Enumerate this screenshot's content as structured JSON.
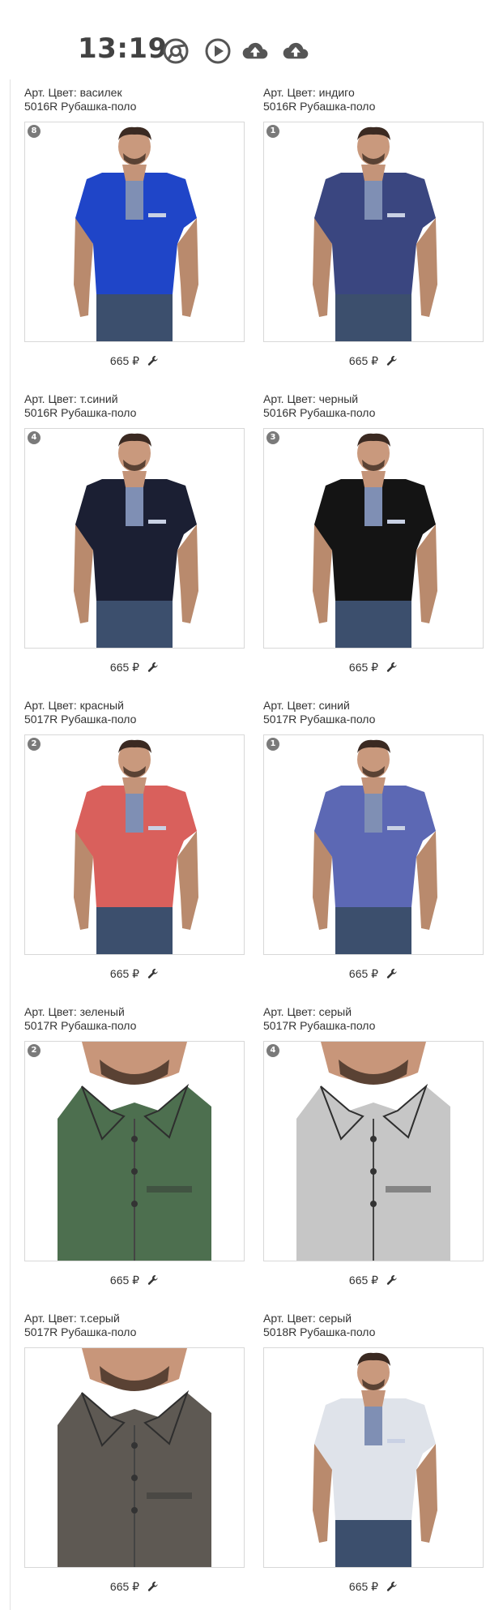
{
  "status_bar": {
    "time": "13:19",
    "icons": [
      "chrome-icon",
      "play-circle-icon",
      "cloud-upload-icon",
      "cloud-upload-icon"
    ]
  },
  "products": [
    {
      "color": "Арт. Цвет: василек",
      "model": "5016R Рубашка-поло",
      "badge": "8",
      "price": "665 ₽",
      "shirt_color": "#1f45c8",
      "photo": "full"
    },
    {
      "color": "Арт. Цвет: индиго",
      "model": "5016R Рубашка-поло",
      "badge": "1",
      "price": "665 ₽",
      "shirt_color": "#3a4680",
      "photo": "full"
    },
    {
      "color": "Арт. Цвет: т.синий",
      "model": "5016R Рубашка-поло",
      "badge": "4",
      "price": "665 ₽",
      "shirt_color": "#1b1f33",
      "photo": "full"
    },
    {
      "color": "Арт. Цвет: черный",
      "model": "5016R Рубашка-поло",
      "badge": "3",
      "price": "665 ₽",
      "shirt_color": "#141414",
      "photo": "full"
    },
    {
      "color": "Арт. Цвет: красный",
      "model": "5017R Рубашка-поло",
      "badge": "2",
      "price": "665 ₽",
      "shirt_color": "#d9605c",
      "photo": "full"
    },
    {
      "color": "Арт. Цвет: синий",
      "model": "5017R Рубашка-поло",
      "badge": "1",
      "price": "665 ₽",
      "shirt_color": "#5c68b4",
      "photo": "full"
    },
    {
      "color": "Арт. Цвет: зеленый",
      "model": "5017R Рубашка-поло",
      "badge": "2",
      "price": "665 ₽",
      "shirt_color": "#4d6f4f",
      "photo": "closeup"
    },
    {
      "color": "Арт. Цвет: серый",
      "model": "5017R Рубашка-поло",
      "badge": "4",
      "price": "665 ₽",
      "shirt_color": "#c6c6c6",
      "photo": "closeup"
    },
    {
      "color": "Арт. Цвет: т.серый",
      "model": "5017R Рубашка-поло",
      "badge": "",
      "price": "665 ₽",
      "shirt_color": "#5e5953",
      "photo": "closeup"
    },
    {
      "color": "Арт. Цвет: серый",
      "model": "5018R Рубашка-поло",
      "badge": "",
      "price": "665 ₽",
      "shirt_color": "#dfe3ea",
      "photo": "full"
    }
  ]
}
